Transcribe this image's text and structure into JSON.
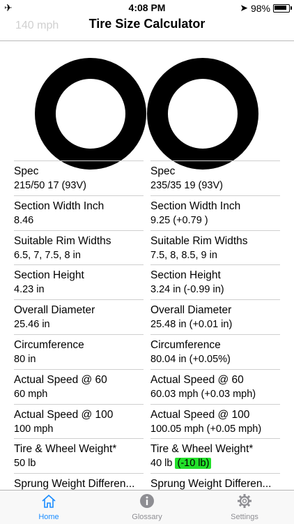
{
  "status_bar": {
    "time": "4:08 PM",
    "battery": "98%"
  },
  "nav": {
    "title": "Tire Size Calculator",
    "ghost_text": "140 mph"
  },
  "rows": [
    {
      "label": "Spec",
      "left": "215/50 17 (93V)",
      "right": "235/35 19 (93V)"
    },
    {
      "label": "Section Width Inch",
      "left": "8.46",
      "right": "9.25 (+0.79 )"
    },
    {
      "label": "Suitable Rim Widths",
      "left": "6.5, 7, 7.5, 8 in",
      "right": "7.5, 8, 8.5, 9 in"
    },
    {
      "label": "Section Height",
      "left": "4.23 in",
      "right": "3.24 in (-0.99 in)"
    },
    {
      "label": "Overall Diameter",
      "left": "25.46 in",
      "right": "25.48 in (+0.01 in)"
    },
    {
      "label": "Circumference",
      "left": "80 in",
      "right": "80.04 in (+0.05%)"
    },
    {
      "label": "Actual Speed @ 60",
      "left": "60 mph",
      "right": "60.03 mph (+0.03 mph)"
    },
    {
      "label": "Actual Speed @ 100",
      "left": "100 mph",
      "right": "100.05 mph (+0.05 mph)"
    },
    {
      "label": "Tire & Wheel Weight*",
      "left": "50 lb",
      "right": "40 lb",
      "right_diff": "(-10 lb)"
    },
    {
      "label": "Sprung Weight Differen...",
      "left": "",
      "right": ""
    }
  ],
  "tabs": {
    "home": "Home",
    "glossary": "Glossary",
    "settings": "Settings"
  },
  "colors": {
    "accent": "#1a8cff",
    "highlight": "#22e02a",
    "tire": "#000000"
  }
}
